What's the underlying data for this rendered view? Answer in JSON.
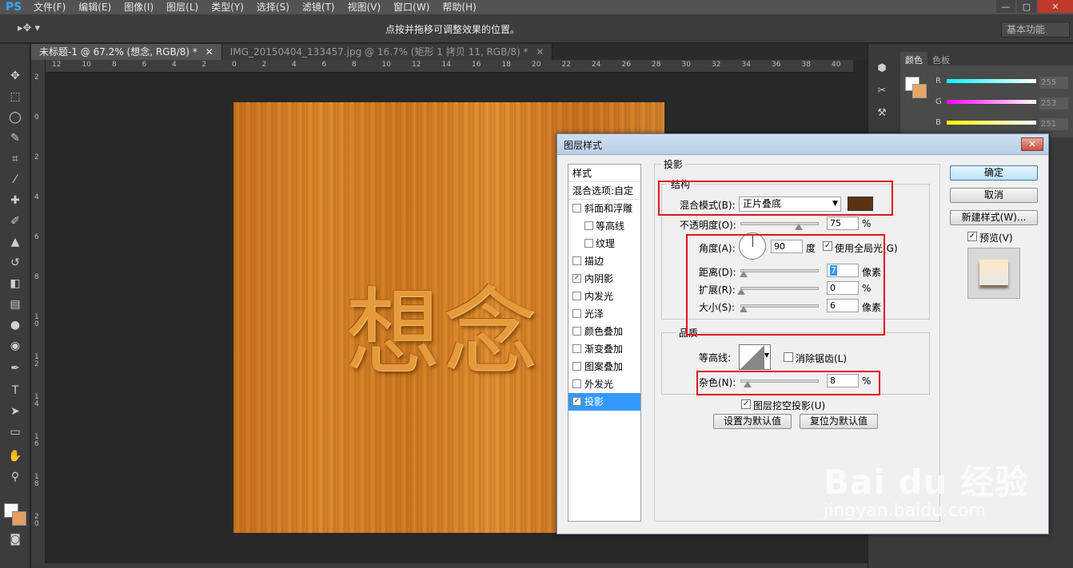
{
  "app": {
    "logo": "PS",
    "menu": [
      "文件(F)",
      "编辑(E)",
      "图像(I)",
      "图层(L)",
      "类型(Y)",
      "选择(S)",
      "滤镜(T)",
      "视图(V)",
      "窗口(W)",
      "帮助(H)"
    ],
    "window_controls": [
      "—",
      "▢",
      "✕"
    ]
  },
  "options_bar": {
    "tool_glyph": "▸✥ ▾",
    "hint": "点按并拖移可调整效果的位置。",
    "workspace": "基本功能"
  },
  "tabs": [
    {
      "label": "未标题-1 @ 67.2% (想念, RGB/8) *",
      "close": "✕",
      "active": true
    },
    {
      "label": "IMG_20150404_133457.jpg @ 16.7% (矩形 1 拷贝 11, RGB/8) *",
      "close": "✕",
      "active": false
    }
  ],
  "ruler_top_ticks": [
    "12",
    "10",
    "8",
    "6",
    "4",
    "2",
    "0",
    "2",
    "4",
    "6",
    "8",
    "10",
    "12",
    "14",
    "16",
    "18",
    "20",
    "22",
    "24",
    "26",
    "28",
    "30",
    "32",
    "34",
    "36",
    "38",
    "40"
  ],
  "ruler_left_ticks": [
    "2",
    "0",
    "2",
    "4",
    "6",
    "8",
    "1\n0",
    "1\n2",
    "1\n4",
    "1\n6",
    "1\n8",
    "2\n0"
  ],
  "canvas": {
    "text": "想念",
    "texture_color": "#d4832b"
  },
  "panels": {
    "tabs": [
      "颜色",
      "色板"
    ],
    "channels": [
      {
        "name": "R",
        "value": "255"
      },
      {
        "name": "G",
        "value": "253"
      },
      {
        "name": "B",
        "value": "251"
      }
    ]
  },
  "dialog": {
    "title": "图层样式",
    "close": "✕",
    "style_list": {
      "header": "样式",
      "blend_options": "混合选项:自定",
      "items": [
        {
          "label": "斜面和浮雕",
          "checked": false,
          "sub": false
        },
        {
          "label": "等高线",
          "checked": false,
          "sub": true
        },
        {
          "label": "纹理",
          "checked": false,
          "sub": true
        },
        {
          "label": "描边",
          "checked": false,
          "sub": false
        },
        {
          "label": "内阴影",
          "checked": true,
          "sub": false
        },
        {
          "label": "内发光",
          "checked": false,
          "sub": false
        },
        {
          "label": "光泽",
          "checked": false,
          "sub": false
        },
        {
          "label": "颜色叠加",
          "checked": false,
          "sub": false
        },
        {
          "label": "渐变叠加",
          "checked": false,
          "sub": false
        },
        {
          "label": "图案叠加",
          "checked": false,
          "sub": false
        },
        {
          "label": "外发光",
          "checked": false,
          "sub": false
        },
        {
          "label": "投影",
          "checked": true,
          "sub": false,
          "selected": true
        }
      ]
    },
    "section_title": "投影",
    "structure": {
      "legend": "结构",
      "blend_mode_label": "混合模式(B):",
      "blend_mode_value": "正片叠底",
      "shadow_color": "#5a3410",
      "opacity_label": "不透明度(O):",
      "opacity_value": "75",
      "opacity": 0.75,
      "percent": "%",
      "angle_label": "角度(A):",
      "angle_value": "90",
      "angle_unit": "度",
      "global_light_label": "使用全局光(G)",
      "global_light_checked": true,
      "distance_label": "距离(D):",
      "distance_value": "7",
      "distance": 0.03,
      "pixels": "像素",
      "spread_label": "扩展(R):",
      "spread_value": "0",
      "spread": 0.0,
      "size_label": "大小(S):",
      "size_value": "6",
      "size": 0.03
    },
    "quality": {
      "legend": "品质",
      "contour_label": "等高线:",
      "anti_alias_label": "消除锯齿(L)",
      "anti_alias_checked": false,
      "noise_label": "杂色(N):",
      "noise_value": "8",
      "noise": 0.08,
      "knockout_label": "图层挖空投影(U)",
      "knockout_checked": true,
      "make_default": "设置为默认值",
      "reset_default": "复位为默认值"
    },
    "buttons": {
      "ok": "确定",
      "cancel": "取消",
      "new_style": "新建样式(W)...",
      "preview_label": "预览(V)",
      "preview_checked": true
    }
  },
  "watermark": {
    "big": "Bai du 经验",
    "small": "jingyan.baidu.com"
  },
  "check_glyph": "✓"
}
